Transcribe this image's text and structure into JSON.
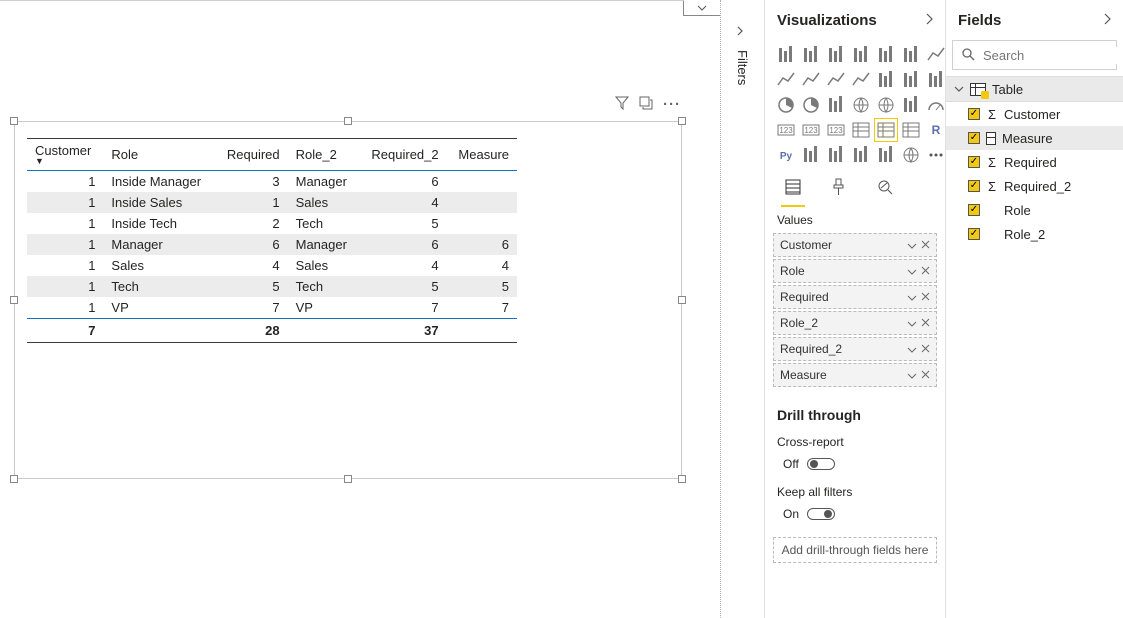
{
  "table": {
    "headers": [
      "Customer",
      "Role",
      "Required",
      "Role_2",
      "Required_2",
      "Measure"
    ],
    "rows": [
      {
        "customer": 1,
        "role": "Inside Manager",
        "required": 3,
        "role2": "Manager",
        "required2": 6,
        "measure": ""
      },
      {
        "customer": 1,
        "role": "Inside Sales",
        "required": 1,
        "role2": "Sales",
        "required2": 4,
        "measure": ""
      },
      {
        "customer": 1,
        "role": "Inside Tech",
        "required": 2,
        "role2": "Tech",
        "required2": 5,
        "measure": ""
      },
      {
        "customer": 1,
        "role": "Manager",
        "required": 6,
        "role2": "Manager",
        "required2": 6,
        "measure": 6
      },
      {
        "customer": 1,
        "role": "Sales",
        "required": 4,
        "role2": "Sales",
        "required2": 4,
        "measure": 4
      },
      {
        "customer": 1,
        "role": "Tech",
        "required": 5,
        "role2": "Tech",
        "required2": 5,
        "measure": 5
      },
      {
        "customer": 1,
        "role": "VP",
        "required": 7,
        "role2": "VP",
        "required2": 7,
        "measure": 7
      }
    ],
    "totals": {
      "customer": 7,
      "required": 28,
      "required2": 37
    }
  },
  "panes": {
    "visualizations": "Visualizations",
    "fields": "Fields",
    "filters": "Filters"
  },
  "wells": {
    "label": "Values",
    "items": [
      "Customer",
      "Role",
      "Required",
      "Role_2",
      "Required_2",
      "Measure"
    ]
  },
  "drill": {
    "header": "Drill through",
    "cross": "Cross-report",
    "off": "Off",
    "keep": "Keep all filters",
    "on": "On",
    "drop": "Add drill-through fields here"
  },
  "fields": {
    "search_placeholder": "Search",
    "table_name": "Table",
    "items": [
      {
        "name": "Customer",
        "type": "sigma"
      },
      {
        "name": "Measure",
        "type": "calc",
        "selected": true
      },
      {
        "name": "Required",
        "type": "sigma"
      },
      {
        "name": "Required_2",
        "type": "sigma"
      },
      {
        "name": "Role",
        "type": "none"
      },
      {
        "name": "Role_2",
        "type": "none"
      }
    ]
  },
  "viz_gallery": [
    "stacked-bar",
    "stacked-column",
    "clustered-bar",
    "clustered-column",
    "100-stacked-bar",
    "100-stacked-column",
    "line",
    "area",
    "stacked-area",
    "line-stacked-column",
    "line-clustered-column",
    "ribbon",
    "waterfall",
    "scatter",
    "pie",
    "donut",
    "treemap",
    "map",
    "filled-map",
    "funnel",
    "gauge",
    "card",
    "multi-row-card",
    "kpi",
    "slicer",
    "table",
    "matrix",
    "r-visual",
    "python-visual",
    "key-influencers",
    "decomposition-tree",
    "qna",
    "paginated",
    "arcgis",
    "powerapps"
  ]
}
